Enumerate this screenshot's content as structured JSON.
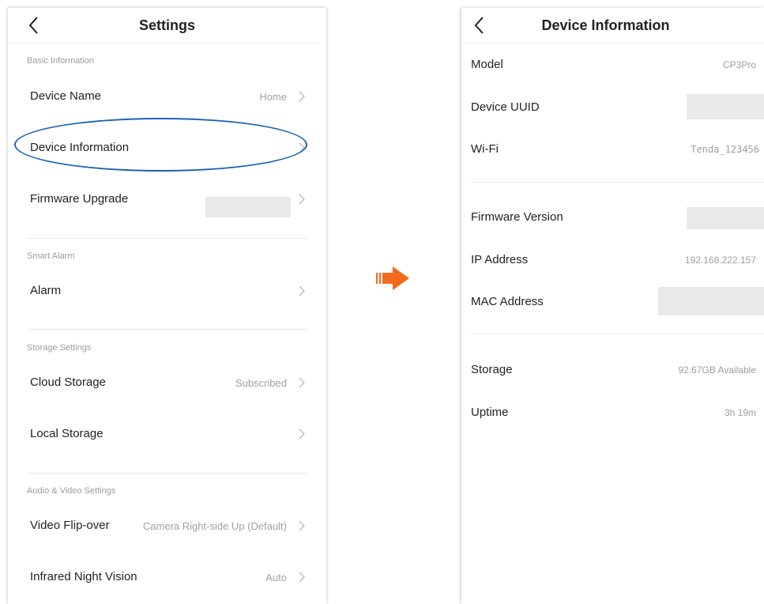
{
  "settings": {
    "title": "Settings",
    "sections": {
      "basic": "Basic Information",
      "alarm": "Smart Alarm",
      "storage": "Storage Settings",
      "av": "Audio & Video Settings"
    },
    "rows": {
      "device_name": {
        "label": "Device Name",
        "value": "Home"
      },
      "device_information": {
        "label": "Device Information"
      },
      "firmware_upgrade": {
        "label": "Firmware Upgrade"
      },
      "alarm": {
        "label": "Alarm"
      },
      "cloud_storage": {
        "label": "Cloud Storage",
        "value": "Subscribed"
      },
      "local_storage": {
        "label": "Local Storage"
      },
      "video_flip": {
        "label": "Video Flip-over",
        "value": "Camera Right-side Up (Default)"
      },
      "infrared": {
        "label": "Infrared Night Vision",
        "value": "Auto"
      }
    }
  },
  "device_info": {
    "title": "Device Information",
    "rows": {
      "model": {
        "label": "Model",
        "value": "CP3Pro"
      },
      "uuid": {
        "label": "Device UUID"
      },
      "wifi": {
        "label": "Wi-Fi",
        "value": "Tenda_123456"
      },
      "firmware": {
        "label": "Firmware Version"
      },
      "ip": {
        "label": "IP Address",
        "value": "192.168.222.157"
      },
      "mac": {
        "label": "MAC Address"
      },
      "storage": {
        "label": "Storage",
        "value": "92.67GB Available"
      },
      "uptime": {
        "label": "Uptime",
        "value": "3h 19m"
      }
    }
  },
  "icons": {
    "back": "chevron-left-icon",
    "row_arrow": "chevron-right-icon",
    "transition": "arrow-right-icon"
  },
  "colors": {
    "highlight": "#1c63b8",
    "arrow": "#f26a1b",
    "redacted": "#e9e9e9"
  }
}
